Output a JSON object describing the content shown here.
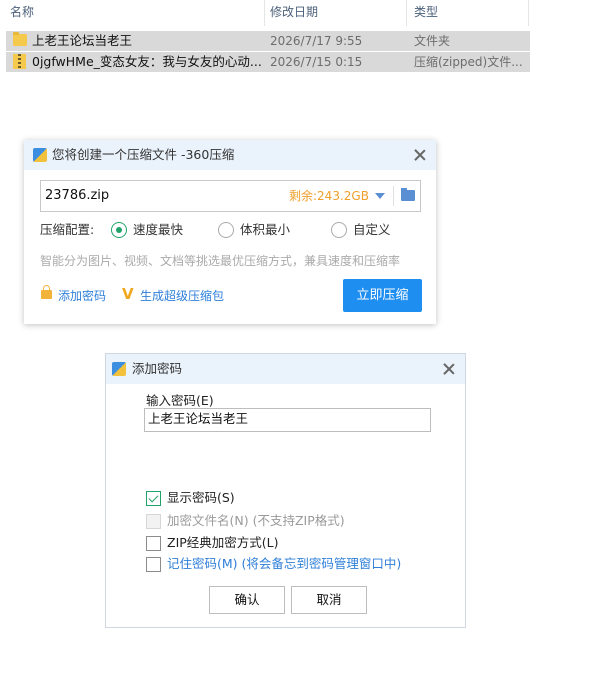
{
  "explorer": {
    "columns": {
      "name": "名称",
      "date": "修改日期",
      "type": "类型"
    },
    "rows": [
      {
        "name": "上老王论坛当老王",
        "date": "2026/7/17 9:55",
        "type": "文件夹",
        "icon": "folder-icon"
      },
      {
        "name": "0jgfwHMe_变态女友：我与女友的心动...",
        "date": "2026/7/15 0:15",
        "type": "压缩(zipped)文件...",
        "icon": "zip-archive-icon"
      }
    ]
  },
  "compress_dialog": {
    "title": "您将创建一个压缩文件 -360压缩",
    "filename": "23786.zip",
    "free_space": "剩余:243.2GB",
    "config_label": "压缩配置:",
    "options": [
      {
        "label": "速度最快",
        "selected": true
      },
      {
        "label": "体积最小",
        "selected": false
      },
      {
        "label": "自定义",
        "selected": false
      }
    ],
    "hint": "智能分为图片、视频、文档等挑选最优压缩方式，兼具速度和压缩率",
    "add_password_link": "添加密码",
    "super_archive_link": "生成超级压缩包",
    "compress_button": "立即压缩",
    "accent_color": "#1f8ef1"
  },
  "password_dialog": {
    "title": "添加密码",
    "input_label": "输入密码(E)",
    "password_value": "上老王论坛当老王",
    "checkboxes": [
      {
        "label": "显示密码(S)",
        "checked": true,
        "disabled": false
      },
      {
        "label": "加密文件名(N) (不支持ZIP格式)",
        "checked": false,
        "disabled": true
      },
      {
        "label": "ZIP经典加密方式(L)",
        "checked": false,
        "disabled": false
      },
      {
        "label": "记住密码(M) (将会备忘到密码管理窗口中)",
        "checked": false,
        "disabled": false
      }
    ],
    "ok_button": "确认",
    "cancel_button": "取消"
  }
}
